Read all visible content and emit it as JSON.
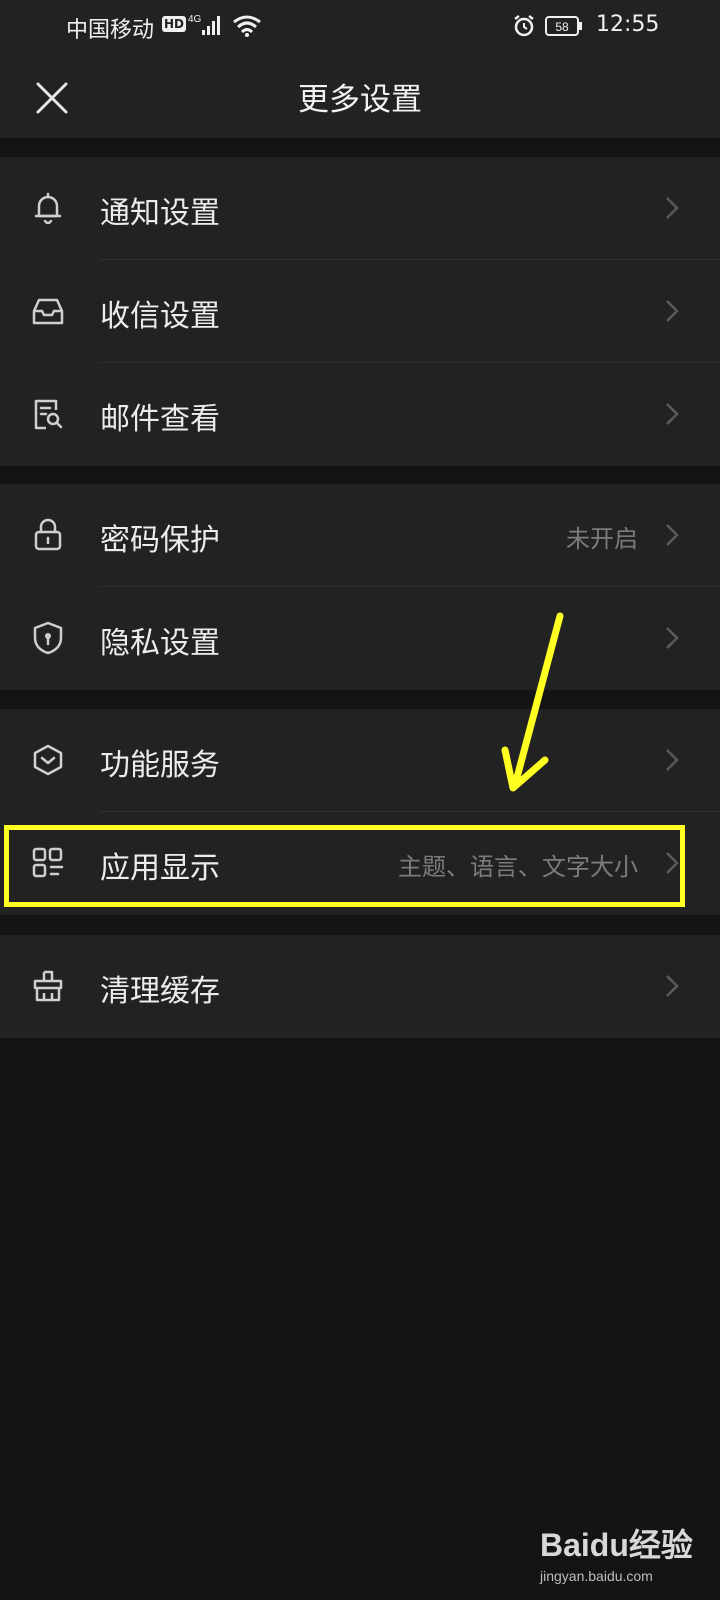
{
  "status_bar": {
    "carrier": "中国移动",
    "hd_badge": "HD",
    "network": "4G",
    "battery": "58",
    "time": "12:55"
  },
  "header": {
    "title": "更多设置"
  },
  "groups": [
    [
      {
        "label": "通知设置",
        "icon": "bell-icon"
      },
      {
        "label": "收信设置",
        "icon": "inbox-icon"
      },
      {
        "label": "邮件查看",
        "icon": "mail-view-icon"
      }
    ],
    [
      {
        "label": "密码保护",
        "value": "未开启",
        "icon": "lock-icon"
      },
      {
        "label": "隐私设置",
        "icon": "shield-lock-icon"
      }
    ],
    [
      {
        "label": "功能服务",
        "icon": "box-icon"
      },
      {
        "label": "应用显示",
        "value": "主题、语言、文字大小",
        "icon": "grid-icon"
      }
    ],
    [
      {
        "label": "清理缓存",
        "icon": "broom-icon"
      }
    ]
  ],
  "annotation_color": "#ffff22",
  "watermark": {
    "logo": "Baidu经验",
    "url": "jingyan.baidu.com"
  }
}
